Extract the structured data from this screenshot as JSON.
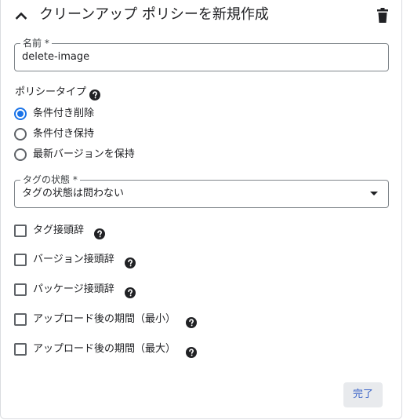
{
  "header": {
    "title": "クリーンアップ ポリシーを新規作成"
  },
  "name_field": {
    "label": "名前 *",
    "value": "delete-image"
  },
  "policy_type": {
    "label": "ポリシータイプ",
    "options": [
      {
        "label": "条件付き削除",
        "selected": true
      },
      {
        "label": "条件付き保持",
        "selected": false
      },
      {
        "label": "最新バージョンを保持",
        "selected": false
      }
    ]
  },
  "tag_state": {
    "label": "タグの状態 *",
    "value": "タグの状態は問わない"
  },
  "conditions": [
    {
      "label": "タグ接頭辞",
      "checked": false
    },
    {
      "label": "バージョン接頭辞",
      "checked": false
    },
    {
      "label": "パッケージ接頭辞",
      "checked": false
    },
    {
      "label": "アップロード後の期間（最小）",
      "checked": false
    },
    {
      "label": "アップロード後の期間（最大）",
      "checked": false
    }
  ],
  "actions": {
    "done_label": "完了"
  },
  "colors": {
    "accent": "#1a73e8",
    "done_text": "#3b64c8",
    "done_bg": "#e8eaed"
  },
  "icons": [
    "chevron-up-icon",
    "trash-icon",
    "help-icon",
    "dropdown-arrow-icon"
  ]
}
